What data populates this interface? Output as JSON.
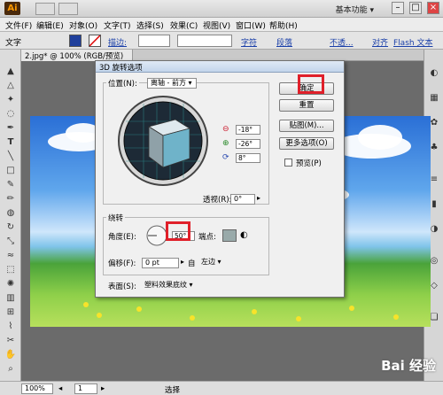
{
  "app": {
    "logo": "Ai",
    "workspace": "基本功能 ▾"
  },
  "menu": [
    "文件(F)",
    "编辑(E)",
    "对象(O)",
    "文字(T)",
    "选择(S)",
    "效果(C)",
    "视图(V)",
    "窗口(W)",
    "帮助(H)"
  ],
  "control": {
    "label": "文字",
    "stroke_label": "描边:",
    "char_link": "字符",
    "para_link": "段落",
    "opacity_label": "不透...",
    "align_link": "对齐",
    "flash_link": "Flash 文本"
  },
  "document": {
    "tab": "2.jpg* @ 100% (RGB/预览)"
  },
  "dialog": {
    "title": "3D 旋转选项",
    "position_label": "位置(N):",
    "position_value": "离轴 - 前方",
    "rot_x": "-18°",
    "rot_y": "-26°",
    "rot_z": "8°",
    "perspective_label": "透视(R):",
    "perspective_value": "0°",
    "rotation_group": "绕转",
    "angle_label": "角度(E):",
    "angle_value": "50°",
    "endpoint_label": "端点:",
    "offset_label": "偏移(F):",
    "offset_value": "0 pt",
    "from_label": "自",
    "from_value": "左边",
    "surface_label": "表面(S):",
    "surface_value": "塑料效果底纹",
    "ok": "确定",
    "reset": "重置",
    "map": "贴图(M)...",
    "more": "更多选项(O)",
    "preview": "预览(P)"
  },
  "status": {
    "zoom": "100%",
    "page": "1",
    "tool": "选择"
  },
  "watermark": "Bai 经验"
}
